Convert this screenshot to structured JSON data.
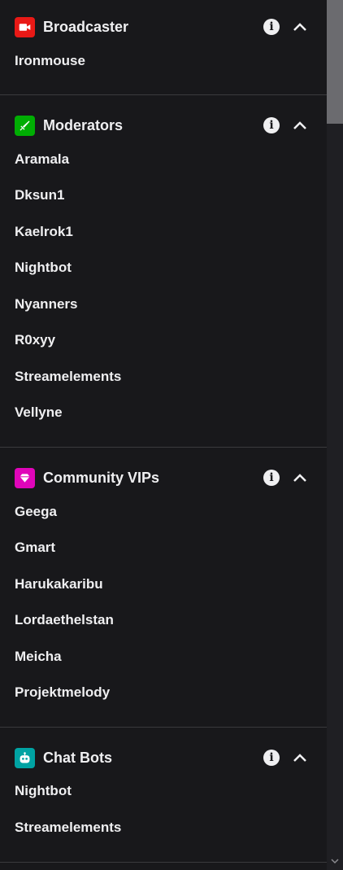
{
  "sections": [
    {
      "title": "Broadcaster",
      "badge_color": "#e91916",
      "badge_icon": "video-camera-icon",
      "users": [
        "Ironmouse"
      ]
    },
    {
      "title": "Moderators",
      "badge_color": "#00ad03",
      "badge_icon": "sword-icon",
      "users": [
        "Aramala",
        "Dksun1",
        "Kaelrok1",
        "Nightbot",
        "Nyanners",
        "R0xyy",
        "Streamelements",
        "Vellyne"
      ]
    },
    {
      "title": "Community VIPs",
      "badge_color": "#e005b9",
      "badge_icon": "diamond-icon",
      "users": [
        "Geega",
        "Gmart",
        "Harukakaribu",
        "Lordaethelstan",
        "Meicha",
        "Projektmelody"
      ]
    },
    {
      "title": "Chat Bots",
      "badge_color": "#00a3a3",
      "badge_icon": "robot-icon",
      "users": [
        "Nightbot",
        "Streamelements"
      ]
    }
  ],
  "info_glyph": "i",
  "colors": {
    "background": "#18181b",
    "text": "#efeff1",
    "divider": "#3a3a3d",
    "scrollbar_thumb": "#6b6b6f"
  }
}
